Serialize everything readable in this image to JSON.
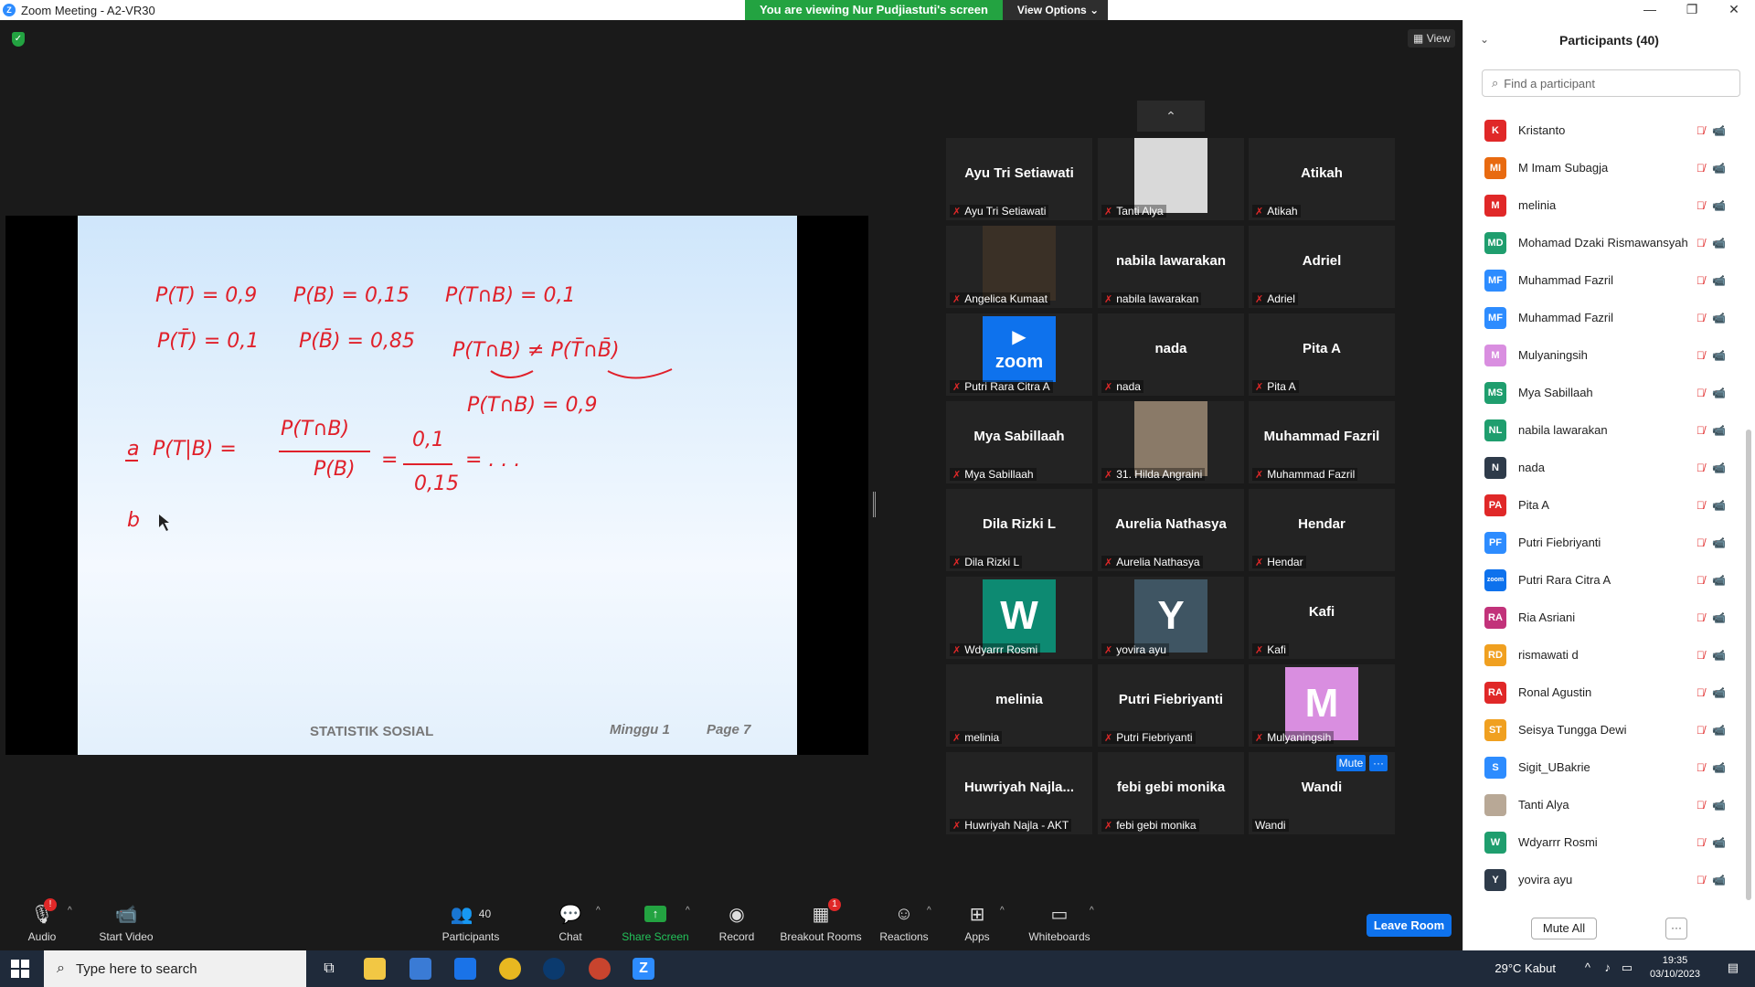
{
  "window": {
    "title": "Zoom Meeting - A2-VR30",
    "controls": [
      "—",
      "❐",
      "✕"
    ]
  },
  "banner": {
    "viewing": "You are viewing Nur Pudjiastuti's screen",
    "view_options": "View Options"
  },
  "meeting": {
    "view_label": "View"
  },
  "slide": {
    "handwriting": {
      "line1a": "P(T) = 0,9",
      "line1b": "P(B) = 0,15",
      "line1c": "P(T∩B) = 0,1",
      "line2a": "P(T̄) = 0,1",
      "line2b": "P(B̄) = 0,85",
      "line2c": "P(T∩B) ≠ P(T̄∩B̄)",
      "line3": "P(T∩B) = 0,9",
      "a_label": "a",
      "a_lhs": "P(T|B) =",
      "a_num": "P(T∩B)",
      "a_den": "P(B)",
      "a_eq": "=",
      "a_num2": "0,1",
      "a_den2": "0,15",
      "a_dots": "= . . .",
      "b_label": "b"
    },
    "footer_left": "STATISTIK SOSIAL",
    "footer_week": "Minggu 1",
    "footer_page": "Page 7"
  },
  "gallery": {
    "tiles": [
      {
        "name": "Ayu Tri Setiawati",
        "caption": "Ayu Tri Setiawati",
        "kind": "name"
      },
      {
        "name": "",
        "caption": "Tanti Alya",
        "kind": "photo",
        "photo_color": "#d9d9d9"
      },
      {
        "name": "Atikah",
        "caption": "Atikah",
        "kind": "name"
      },
      {
        "name": "",
        "caption": "Angelica Kumaat",
        "kind": "photo",
        "photo_color": "#3a3026"
      },
      {
        "name": "nabila lawarakan",
        "caption": "nabila lawarakan",
        "kind": "name"
      },
      {
        "name": "Adriel",
        "caption": "Adriel",
        "kind": "name"
      },
      {
        "name": "zoom",
        "caption": "Putri Rara Citra A",
        "kind": "zoom"
      },
      {
        "name": "nada",
        "caption": "nada",
        "kind": "name"
      },
      {
        "name": "Pita A",
        "caption": "Pita A",
        "kind": "name"
      },
      {
        "name": "Mya Sabillaah",
        "caption": "Mya Sabillaah",
        "kind": "name"
      },
      {
        "name": "",
        "caption": "31. Hilda Angraini",
        "kind": "photo",
        "photo_color": "#8a7a68"
      },
      {
        "name": "Muhammad Fazril",
        "caption": "Muhammad Fazril",
        "kind": "name"
      },
      {
        "name": "Dila Rizki L",
        "caption": "Dila Rizki L",
        "kind": "name"
      },
      {
        "name": "Aurelia Nathasya",
        "caption": "Aurelia Nathasya",
        "kind": "name"
      },
      {
        "name": "Hendar",
        "caption": "Hendar",
        "kind": "name"
      },
      {
        "name": "W",
        "caption": "Wdyarrr Rosmi",
        "kind": "letter",
        "color": "#0d8a72"
      },
      {
        "name": "Y",
        "caption": "yovira ayu",
        "kind": "letter",
        "color": "#3f5563"
      },
      {
        "name": "Kafi",
        "caption": "Kafi",
        "kind": "name"
      },
      {
        "name": "melinia",
        "caption": "melinia",
        "kind": "name"
      },
      {
        "name": "Putri Fiebriyanti",
        "caption": "Putri Fiebriyanti",
        "kind": "name"
      },
      {
        "name": "M",
        "caption": "Mulyaningsih",
        "kind": "letter",
        "color": "#d98ee0"
      },
      {
        "name": "Huwriyah  Najla...",
        "caption": "Huwriyah Najla - AKT",
        "kind": "name"
      },
      {
        "name": "febi gebi monika",
        "caption": "febi gebi monika",
        "kind": "name"
      },
      {
        "name": "Wandi",
        "caption": "Wandi",
        "kind": "name",
        "no_mic": true
      }
    ],
    "mute_label": "Mute",
    "more_label": "···"
  },
  "toolbar": {
    "audio": "Audio",
    "audio_badge": "!",
    "start_video": "Start Video",
    "participants": "Participants",
    "participants_count": "40",
    "chat": "Chat",
    "share_screen": "Share Screen",
    "record": "Record",
    "breakout_rooms": "Breakout Rooms",
    "breakout_badge": "1",
    "reactions": "Reactions",
    "apps": "Apps",
    "whiteboards": "Whiteboards",
    "leave": "Leave Room"
  },
  "participants_panel": {
    "title": "Participants (40)",
    "search_placeholder": "Find a participant",
    "rows": [
      {
        "initials": "K",
        "name": "Kristanto",
        "color": "#e02828"
      },
      {
        "initials": "MI",
        "name": "M Imam Subagja",
        "color": "#e86a10"
      },
      {
        "initials": "M",
        "name": "melinia",
        "color": "#e02828"
      },
      {
        "initials": "MD",
        "name": "Mohamad Dzaki Rismawansyah",
        "color": "#1f9e6e"
      },
      {
        "initials": "MF",
        "name": "Muhammad Fazril",
        "color": "#2d8cff"
      },
      {
        "initials": "MF",
        "name": "Muhammad Fazril",
        "color": "#2d8cff"
      },
      {
        "initials": "M",
        "name": "Mulyaningsih",
        "color": "#d98ee0"
      },
      {
        "initials": "MS",
        "name": "Mya Sabillaah",
        "color": "#1f9e6e"
      },
      {
        "initials": "NL",
        "name": "nabila lawarakan",
        "color": "#1f9e6e"
      },
      {
        "initials": "N",
        "name": "nada",
        "color": "#2e3b4a"
      },
      {
        "initials": "PA",
        "name": "Pita A",
        "color": "#e02828"
      },
      {
        "initials": "PF",
        "name": "Putri Fiebriyanti",
        "color": "#2d8cff"
      },
      {
        "initials": "zoom",
        "name": "Putri Rara Citra A",
        "color": "#0e72ed"
      },
      {
        "initials": "RA",
        "name": "Ria Asriani",
        "color": "#c2327a"
      },
      {
        "initials": "RD",
        "name": "rismawati d",
        "color": "#f0a020"
      },
      {
        "initials": "RA",
        "name": "Ronal Agustin",
        "color": "#e02828"
      },
      {
        "initials": "ST",
        "name": "Seisya Tungga Dewi",
        "color": "#f0a020"
      },
      {
        "initials": "S",
        "name": "Sigit_UBakrie",
        "color": "#2d8cff"
      },
      {
        "initials": "",
        "name": "Tanti Alya",
        "color": "#b8a896"
      },
      {
        "initials": "W",
        "name": "Wdyarrr Rosmi",
        "color": "#1f9e6e"
      },
      {
        "initials": "Y",
        "name": "yovira ayu",
        "color": "#2e3b4a"
      }
    ],
    "mute_all": "Mute All",
    "more": "···"
  },
  "taskbar": {
    "search_placeholder": "Type here to search",
    "weather": "29°C  Kabut",
    "time": "19:35",
    "date": "03/10/2023"
  }
}
